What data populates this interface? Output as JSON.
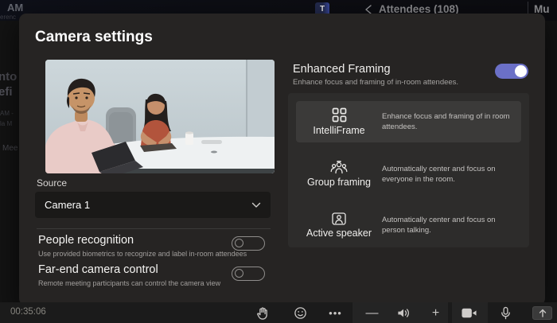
{
  "colors": {
    "accent_toggle_on": "#6b70c7",
    "dialog_bg": "#262423",
    "panel_bg": "#2d2c2b",
    "card_selected_bg": "#3b3a39",
    "bottom_bar_bg": "#1b1b1b"
  },
  "top_bar": {
    "left_fragment": "AM",
    "left_fragment_small": "erenc",
    "teams_badge": "T",
    "attendees_label": "Attendees (108)",
    "mute_fragment": "Mu"
  },
  "background_fragments": {
    "f1": "nto",
    "f2": "efi",
    "f3": "AM -",
    "f4": "la M",
    "f5": "Mee"
  },
  "dialog": {
    "title": "Camera settings",
    "source": {
      "label": "Source",
      "selected": "Camera 1"
    },
    "toggles": [
      {
        "label": "People recognition",
        "description": "Use provided biometrics to recognize and label in-room attendees",
        "state": "off"
      },
      {
        "label": "Far-end camera control",
        "description": "Remote meeting participants can control the camera view",
        "state": "off"
      }
    ],
    "enhanced_framing": {
      "label": "Enhanced Framing",
      "description": "Enhance focus and framing of in-room attendees.",
      "state": "on",
      "options": [
        {
          "label": "IntelliFrame",
          "description": "Enhance focus and framing of in room attendees.",
          "icon": "grid-icon",
          "selected": true
        },
        {
          "label": "Group framing",
          "description": "Automatically center and focus on everyone in the room.",
          "icon": "group-icon",
          "selected": false
        },
        {
          "label": "Active speaker",
          "description": "Automatically center and focus on person talking.",
          "icon": "person-frame-icon",
          "selected": false
        }
      ]
    }
  },
  "bottom_bar": {
    "timer": "00:35:06",
    "icons": [
      "raise-hand",
      "reactions",
      "more-options",
      "volume-down",
      "speaker",
      "volume-up",
      "camera",
      "microphone",
      "share"
    ]
  }
}
